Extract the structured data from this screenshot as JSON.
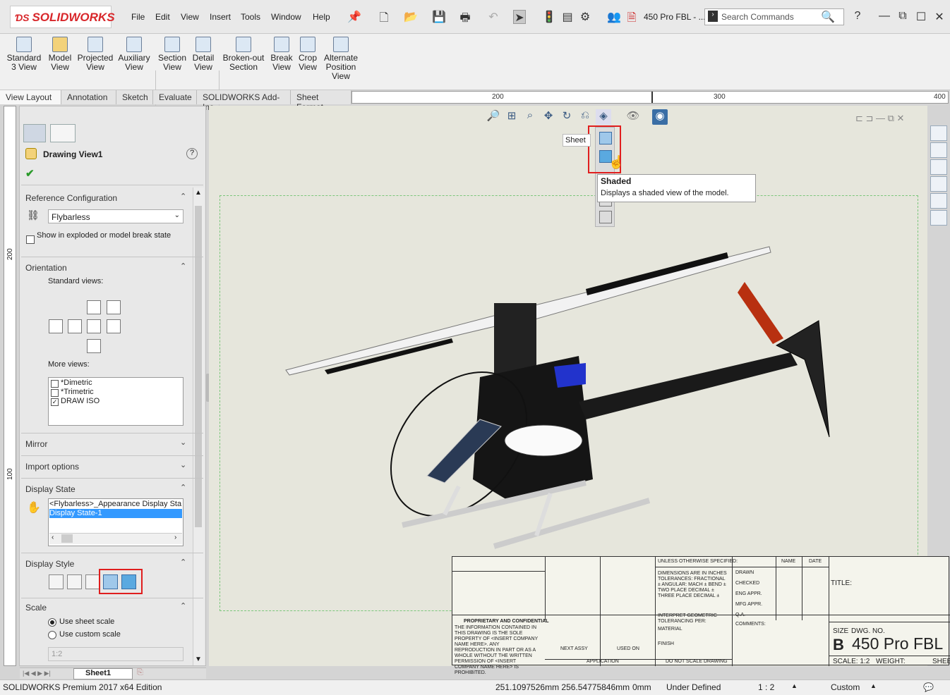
{
  "app": {
    "brand": "SOLIDWORKS",
    "file_name": "450 Pro FBL - ...",
    "search_placeholder": "Search Commands"
  },
  "menus": [
    "File",
    "Edit",
    "View",
    "Insert",
    "Tools",
    "Window",
    "Help"
  ],
  "commands": [
    {
      "label": "Standard\n3 View"
    },
    {
      "label": "Model\nView"
    },
    {
      "label": "Projected\nView"
    },
    {
      "label": "Auxiliary\nView"
    },
    {
      "label": "Section\nView"
    },
    {
      "label": "Detail\nView"
    },
    {
      "label": "Broken-out\nSection"
    },
    {
      "label": "Break\nView"
    },
    {
      "label": "Crop\nView"
    },
    {
      "label": "Alternate\nPosition\nView"
    }
  ],
  "tabs": [
    "View Layout",
    "Annotation",
    "Sketch",
    "Evaluate",
    "SOLIDWORKS Add-Ins",
    "Sheet Format"
  ],
  "ruler": {
    "h": [
      "200",
      "300",
      "400"
    ],
    "v": [
      "200",
      "100"
    ]
  },
  "panel": {
    "title": "Drawing View1",
    "reference_configuration": {
      "label": "Reference Configuration",
      "value": "Flybarless",
      "checkbox": "Show in exploded or model break state"
    },
    "orientation": {
      "label": "Orientation",
      "standard_views": "Standard views:",
      "more_views": "More views:",
      "views": [
        "*Dimetric",
        "*Trimetric",
        "DRAW ISO"
      ]
    },
    "mirror": "Mirror",
    "import_options": "Import options",
    "display_state": {
      "label": "Display State",
      "items": [
        "<Flybarless>_Appearance Display Sta",
        "Display State-1"
      ]
    },
    "display_style": "Display Style",
    "scale": {
      "label": "Scale",
      "option1": "Use sheet scale",
      "option2": "Use custom scale",
      "value": "1:2"
    }
  },
  "sheet_tab": "Sheet1",
  "tooltip": {
    "sheet": "Sheet",
    "title": "Shaded",
    "desc": "Displays a shaded view of the model."
  },
  "titleblock": {
    "unless": "UNLESS OTHERWISE SPECIFIED:",
    "name": "NAME",
    "date": "DATE",
    "dims": "DIMENSIONS ARE IN INCHES TOLERANCES: FRACTIONAL ± ANGULAR: MACH ± BEND ± TWO PLACE DECIMAL ± THREE PLACE DECIMAL ±",
    "drawn": "DRAWN",
    "checked": "CHECKED",
    "eng": "ENG APPR.",
    "mfg": "MFG APPR.",
    "qa": "Q.A.",
    "comments": "COMMENTS:",
    "title": "TITLE:",
    "interp": "INTERPRET GEOMETRIC TOLERANCING PER:",
    "material": "MATERIAL",
    "finish": "FINISH",
    "prop": "PROPRIETARY AND CONFIDENTIAL",
    "propbody": "THE INFORMATION CONTAINED IN THIS DRAWING IS THE SOLE PROPERTY OF <INSERT COMPANY NAME HERE>. ANY REPRODUCTION IN PART OR AS A WHOLE WITHOUT THE WRITTEN PERMISSION OF <INSERT COMPANY NAME HERE> IS PROHIBITED.",
    "next": "NEXT ASSY",
    "used": "USED ON",
    "application": "APPLICATION",
    "noscale": "DO NOT SCALE DRAWING",
    "size": "SIZE",
    "dwg": "DWG.  NO.",
    "size_val": "B",
    "dwg_val": "450 Pro FBL",
    "scale": "SCALE: 1:2",
    "weight": "WEIGHT:",
    "sheet": "SHEE"
  },
  "status": {
    "edition": "SOLIDWORKS Premium 2017 x64 Edition",
    "coords": "251.1097526mm 256.54775846mm",
    "z": "0mm",
    "state": "Under Defined",
    "scale": "1 : 2",
    "units": "Custom"
  }
}
